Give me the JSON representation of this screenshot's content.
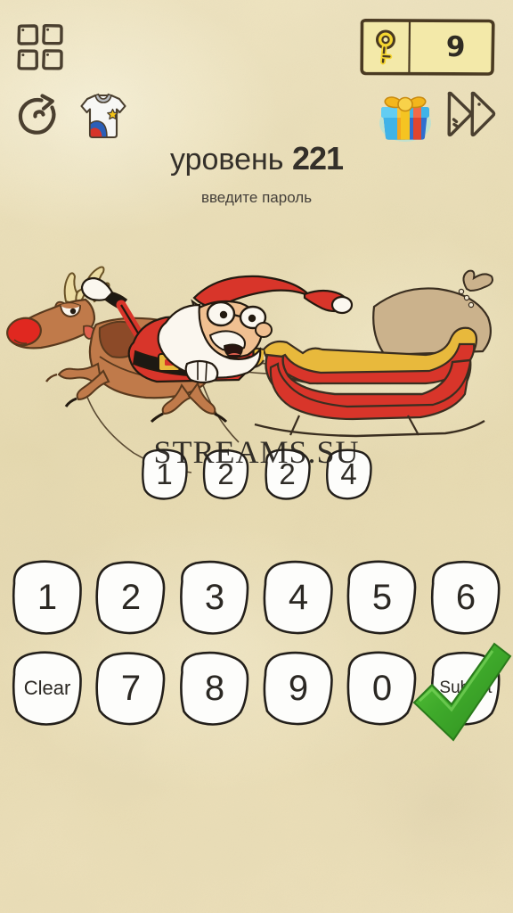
{
  "header": {
    "grid_icon": "grid-menu-icon",
    "restart_icon": "restart-icon",
    "shirt_icon": "tshirt-skin-icon",
    "gift_icon": "gift-box-icon",
    "skip_icon": "fast-forward-icon",
    "key_icon": "key-icon",
    "key_count": "9"
  },
  "title": {
    "level_word": "уровень",
    "level_number": "221",
    "subtitle": "введите пароль"
  },
  "illustration": {
    "name": "santa-sleigh-reindeer",
    "alt": "Santa in a red sleigh with a gift sack pulled by a red-nosed reindeer"
  },
  "watermark": {
    "text": "STREAMS.SU"
  },
  "answer": {
    "tiles": [
      "1",
      "2",
      "2",
      "4"
    ]
  },
  "keypad": {
    "row1": [
      "1",
      "2",
      "3",
      "4",
      "5",
      "6"
    ],
    "row2": [
      "Clear",
      "7",
      "8",
      "9",
      "0",
      "Submit"
    ]
  },
  "colors": {
    "background": "#e9ddb6",
    "ink": "#2e2b26",
    "badge_fill": "#f2e8a8",
    "key_yellow": "#f5d631",
    "sleigh_red": "#d8352a",
    "reindeer_brown": "#c07a4a",
    "check_green": "#3faa2b",
    "tile_white": "#fdfdfb"
  }
}
